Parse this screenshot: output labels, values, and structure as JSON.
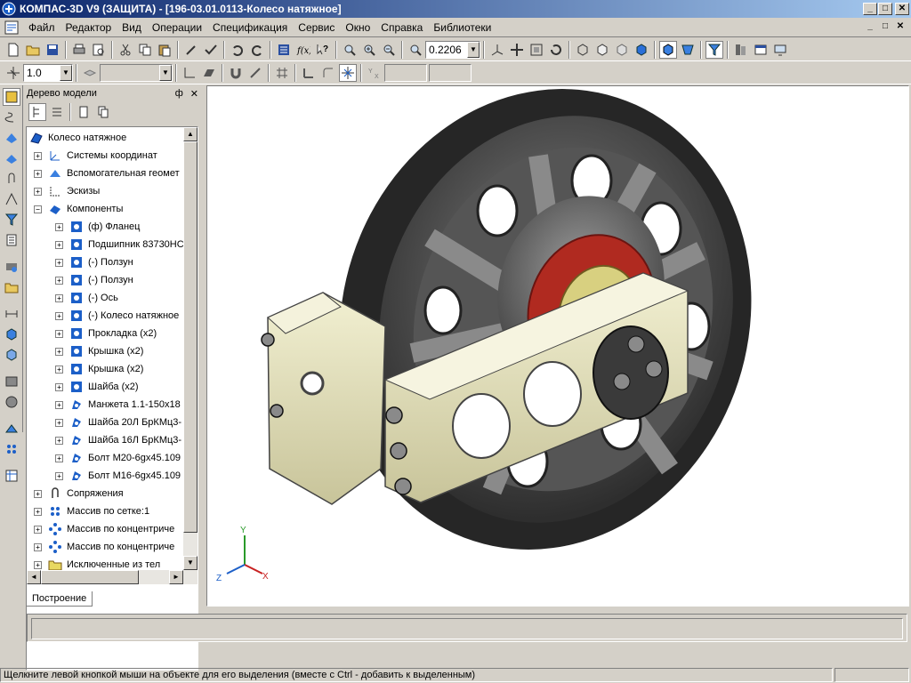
{
  "window": {
    "title": "КОМПАС-3D V9 (ЗАЩИТА) - [196-03.01.0113-Колесо натяжное]",
    "min_label": "_",
    "max_label": "□",
    "close_label": "✕"
  },
  "menu": {
    "items": [
      "Файл",
      "Редактор",
      "Вид",
      "Операции",
      "Спецификация",
      "Сервис",
      "Окно",
      "Справка",
      "Библиотеки"
    ]
  },
  "toolbar": {
    "zoom_value": "0.2206",
    "step_value": "1.0"
  },
  "tree": {
    "header": "Дерево модели",
    "pin_label": "ф",
    "close_label": "✕",
    "root": "Колесо натяжное",
    "rows": [
      {
        "label": "Системы координат",
        "level": 1,
        "sign": "+",
        "icon": "coordinate-system-icon"
      },
      {
        "label": "Вспомогательная геомет",
        "level": 1,
        "sign": "+",
        "icon": "auxiliary-geometry-icon"
      },
      {
        "label": "Эскизы",
        "level": 1,
        "sign": "+",
        "icon": "sketch-icon"
      },
      {
        "label": "Компоненты",
        "level": 1,
        "sign": "−",
        "icon": "components-icon"
      },
      {
        "label": "(ф) Фланец",
        "level": 2,
        "sign": "+",
        "icon": "part-icon"
      },
      {
        "label": "Подшипник 83730НС",
        "level": 2,
        "sign": "+",
        "icon": "part-icon"
      },
      {
        "label": "(-) Ползун",
        "level": 2,
        "sign": "+",
        "icon": "part-icon"
      },
      {
        "label": "(-) Ползун",
        "level": 2,
        "sign": "+",
        "icon": "part-icon"
      },
      {
        "label": "(-) Ось",
        "level": 2,
        "sign": "+",
        "icon": "part-icon"
      },
      {
        "label": "(-) Колесо натяжное",
        "level": 2,
        "sign": "+",
        "icon": "part-icon"
      },
      {
        "label": "Прокладка (x2)",
        "level": 2,
        "sign": "+",
        "icon": "part-icon"
      },
      {
        "label": "Крышка (x2)",
        "level": 2,
        "sign": "+",
        "icon": "part-icon"
      },
      {
        "label": "Крышка (x2)",
        "level": 2,
        "sign": "+",
        "icon": "part-icon"
      },
      {
        "label": "Шайба (x2)",
        "level": 2,
        "sign": "+",
        "icon": "part-icon"
      },
      {
        "label": "Манжета 1.1-150x18",
        "level": 2,
        "sign": "+",
        "icon": "standard-part-icon"
      },
      {
        "label": "Шайба 20Л БрКМц3-",
        "level": 2,
        "sign": "+",
        "icon": "standard-part-icon"
      },
      {
        "label": "Шайба 16Л БрКМц3-",
        "level": 2,
        "sign": "+",
        "icon": "standard-part-icon"
      },
      {
        "label": "Болт М20-6gx45.109",
        "level": 2,
        "sign": "+",
        "icon": "standard-part-icon"
      },
      {
        "label": "Болт М16-6gx45.109",
        "level": 2,
        "sign": "+",
        "icon": "standard-part-icon"
      },
      {
        "label": "Сопряжения",
        "level": 1,
        "sign": "+",
        "icon": "mates-icon"
      },
      {
        "label": "Массив по сетке:1",
        "level": 1,
        "sign": "+",
        "icon": "grid-pattern-icon"
      },
      {
        "label": "Массив по концентриче",
        "level": 1,
        "sign": "+",
        "icon": "circular-pattern-icon"
      },
      {
        "label": "Массив по концентриче",
        "level": 1,
        "sign": "+",
        "icon": "circular-pattern-icon"
      },
      {
        "label": "Исключенные из тел",
        "level": 1,
        "sign": "+",
        "icon": "excluded-folder-icon"
      }
    ]
  },
  "tabs": {
    "build": "Построение"
  },
  "axes": {
    "x": "X",
    "y": "Y",
    "z": "Z"
  },
  "status": {
    "hint": "Щелкните левой кнопкой мыши на объекте для его выделения (вместе с Ctrl - добавить к выделенным)"
  },
  "colors": {
    "titlebar_start": "#0a246a",
    "part_yellow": "#e8e6c0",
    "wheel_dark": "#4a4a4a",
    "flange_red": "#b02a20"
  }
}
